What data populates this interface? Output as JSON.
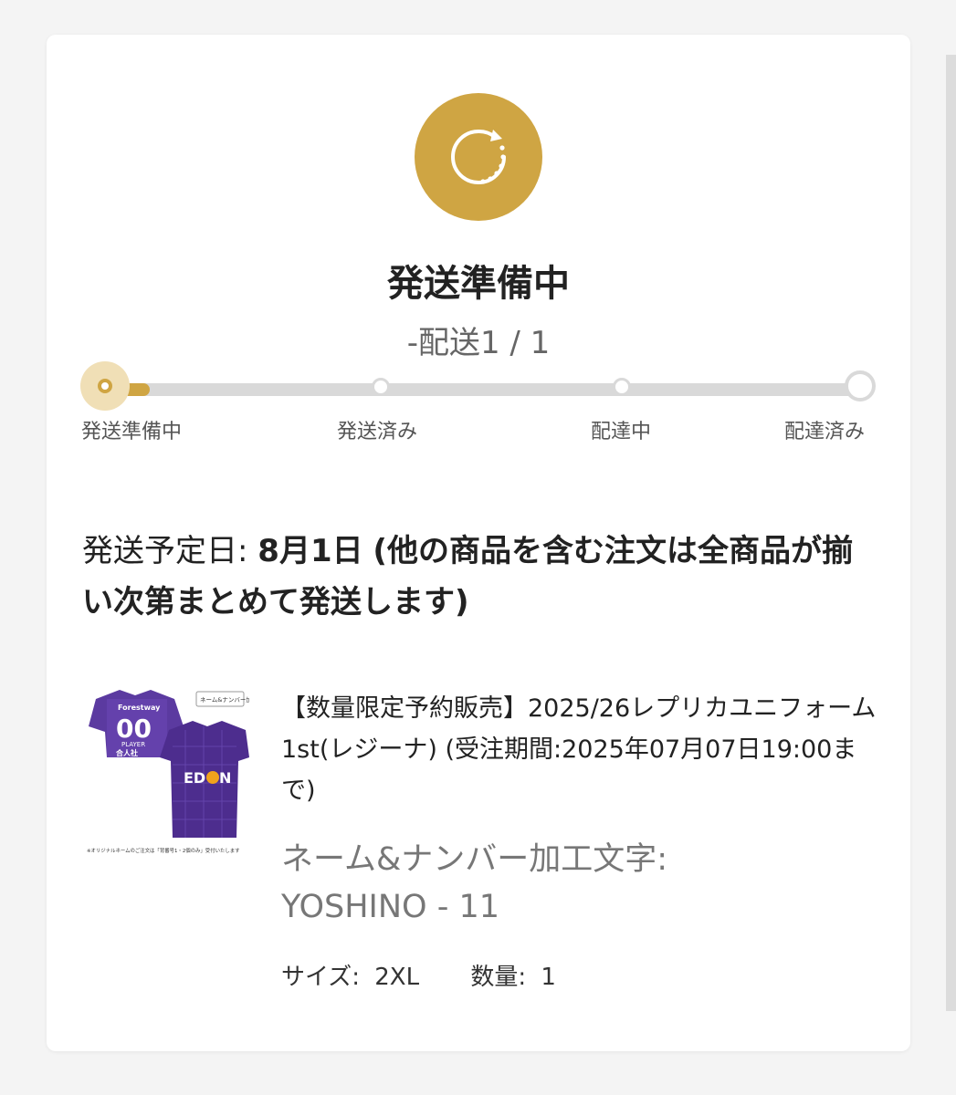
{
  "status": {
    "icon": "refresh-loading-icon",
    "title": "発送準備中",
    "subtitle": "-配送1 / 1",
    "accent_color": "#cfa543"
  },
  "progress": {
    "current_step": 1,
    "fill_fraction": 0.08,
    "steps": [
      {
        "label": "発送準備中"
      },
      {
        "label": "発送済み"
      },
      {
        "label": "配達中"
      },
      {
        "label": "配達済み"
      }
    ]
  },
  "shipping": {
    "label": "発送予定日:",
    "date": "8月1日",
    "note": "(他の商品を含む注文は全商品が揃い次第まとめて発送します)"
  },
  "product": {
    "image_icon": "uniform-jersey-image",
    "image_badge": "ネーム&ナンバー加工",
    "image_caption": "※オリジナルネームのご注文は「背番号1・2個のみ」受付いたします",
    "title": "【数量限定予約販売】2025/26レプリカユニフォーム 1st(レジーナ) (受注期間:2025年07月07日19:00まで)",
    "customization_label": "ネーム&ナンバー加工文字:",
    "customization_value": "YOSHINO - 11",
    "size_label": "サイズ:",
    "size_value": "2XL",
    "qty_label": "数量:",
    "qty_value": "1"
  }
}
